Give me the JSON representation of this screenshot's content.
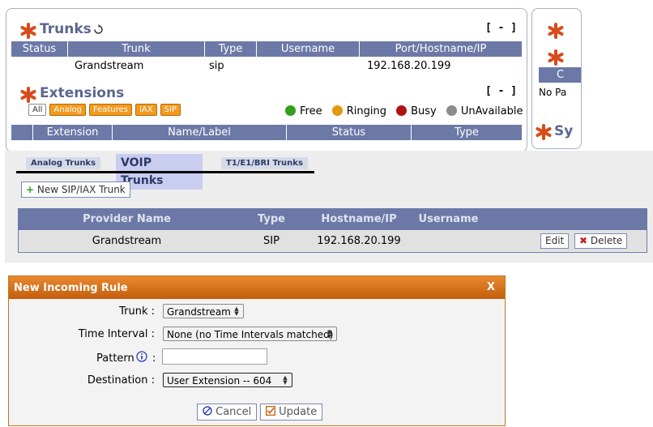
{
  "trunks_widget": {
    "title": "Trunks",
    "collapse": "[ - ]",
    "columns": [
      "Status",
      "Trunk",
      "Type",
      "Username",
      "Port/Hostname/IP"
    ],
    "rows": [
      {
        "status": "",
        "trunk": "Grandstream",
        "type": "sip",
        "username": "",
        "host": "192.168.20.199"
      }
    ]
  },
  "extensions_widget": {
    "title": "Extensions",
    "collapse": "[ - ]",
    "filters": [
      "All",
      "Analog",
      "Features",
      "IAX",
      "SIP"
    ],
    "legend": [
      {
        "label": "Free",
        "color": "#2fa11d"
      },
      {
        "label": "Ringing",
        "color": "#e39a0e"
      },
      {
        "label": "Busy",
        "color": "#b0120f"
      },
      {
        "label": "UnAvailable",
        "color": "#8c8c8c"
      }
    ],
    "columns": [
      "Extension",
      "Name/Label",
      "Status",
      "Type"
    ]
  },
  "side_panel": {
    "text_c": "C",
    "text_nopa": "No Pa",
    "text_sy": "Sy"
  },
  "trunks_page": {
    "tabs": [
      "Analog Trunks",
      "VOIP Trunks",
      "T1/E1/BRI Trunks"
    ],
    "new_button": "New SIP/IAX Trunk",
    "columns": [
      "Provider Name",
      "Type",
      "Hostname/IP",
      "Username"
    ],
    "rows": [
      {
        "provider": "Grandstream",
        "type": "SIP",
        "host": "192.168.20.199",
        "username": "",
        "edit": "Edit",
        "delete": "Delete"
      }
    ]
  },
  "dialog": {
    "title": "New Incoming Rule",
    "close": "X",
    "fields": {
      "trunk_label": "Trunk :",
      "trunk_value": "Grandstream",
      "time_label": "Time Interval :",
      "time_value": "None (no Time Intervals matched)",
      "pattern_label": "Pattern",
      "pattern_colon": ":",
      "pattern_value": "",
      "destination_label": "Destination :",
      "destination_value": "User Extension -- 604"
    },
    "cancel": "Cancel",
    "update": "Update"
  },
  "colors": {
    "header_blue": "#6c79a7",
    "title_orange": "#d9731a",
    "accent_star": "#d84b1a"
  }
}
